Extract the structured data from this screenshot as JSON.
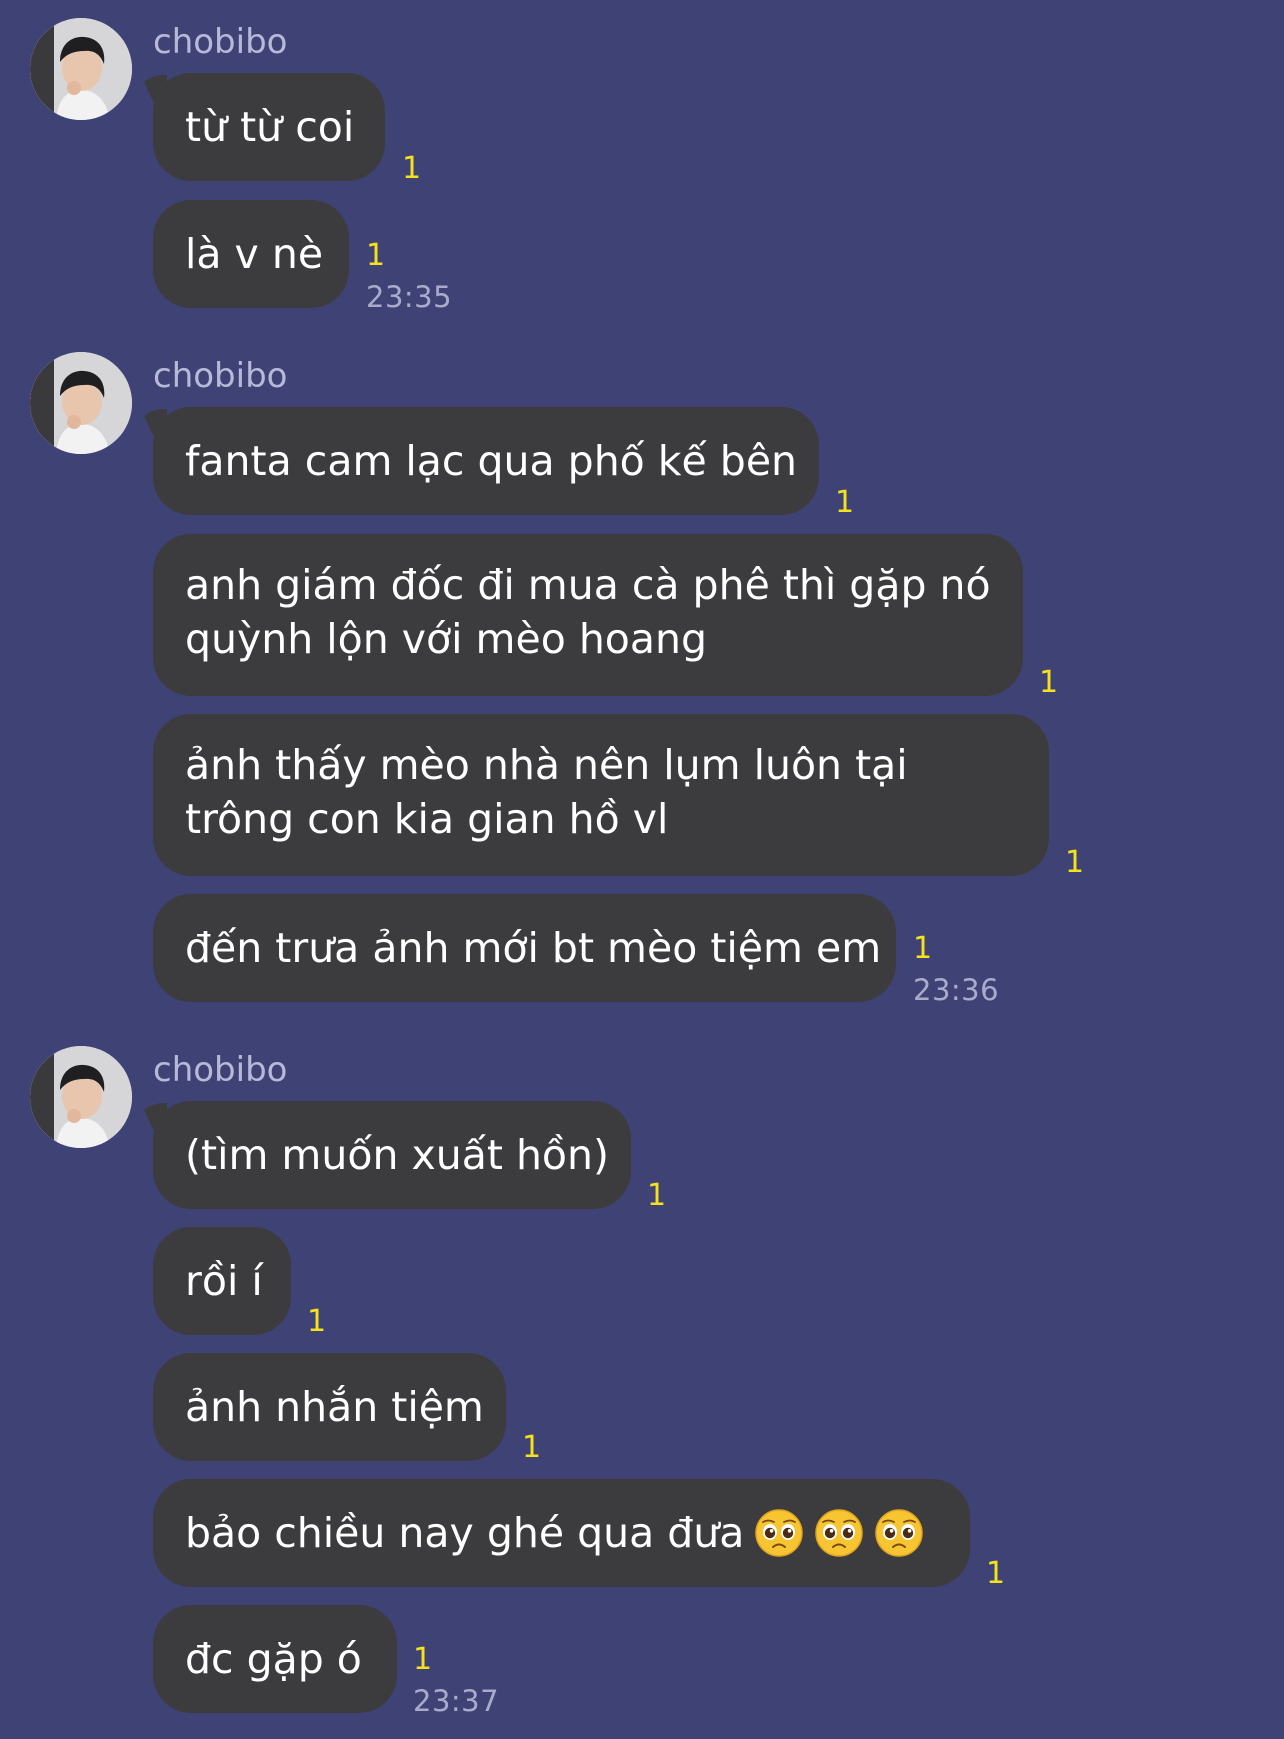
{
  "chat": {
    "groups": [
      {
        "sender": "chobibo",
        "messages": [
          {
            "text": "từ từ coi",
            "read": "1"
          },
          {
            "text": "là v nè",
            "read": "1",
            "time": "23:35"
          }
        ]
      },
      {
        "sender": "chobibo",
        "messages": [
          {
            "text": "fanta cam lạc qua phố kế bên",
            "read": "1"
          },
          {
            "text": "anh giám đốc đi mua cà phê thì gặp nó quỳnh lộn với mèo hoang",
            "read": "1"
          },
          {
            "text": "ảnh thấy mèo nhà nên lụm luôn tại trông con kia gian hồ vl",
            "read": "1"
          },
          {
            "text": "đến trưa ảnh mới bt mèo tiệm em",
            "read": "1",
            "time": "23:36"
          }
        ]
      },
      {
        "sender": "chobibo",
        "messages": [
          {
            "text": "(tìm muốn xuất hồn)",
            "read": "1"
          },
          {
            "text": "rồi í",
            "read": "1"
          },
          {
            "text": "ảnh nhắn tiệm",
            "read": "1"
          },
          {
            "text": "bảo chiều nay ghé qua đưa",
            "read": "1",
            "emojis": [
              "pleading-face-emoji",
              "pleading-face-emoji",
              "pleading-face-emoji"
            ]
          },
          {
            "text": "đc gặp ó",
            "read": "1",
            "time": "23:37"
          }
        ]
      }
    ]
  },
  "colors": {
    "background": "#3f4275",
    "bubble": "#3c3c3e",
    "read_receipt": "#f5e21b",
    "sender_name": "#b7b9d8",
    "timestamp": "#a9abca"
  }
}
